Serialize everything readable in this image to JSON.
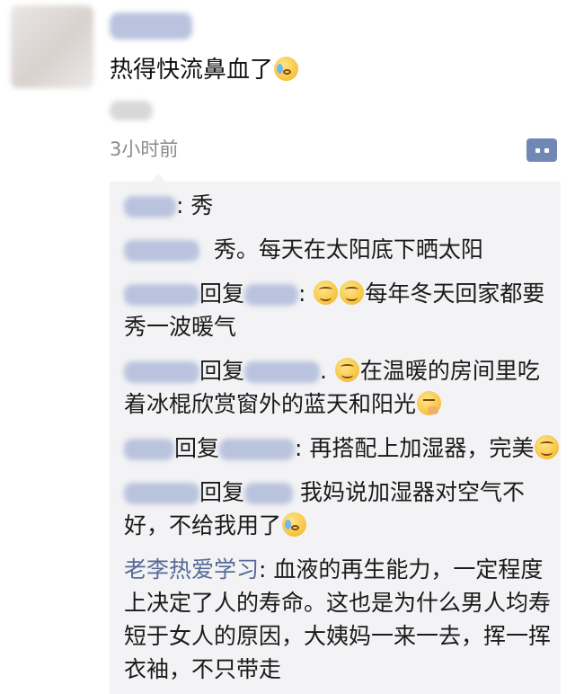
{
  "post": {
    "text": "热得快流鼻血了",
    "text_emoji": "crying-laughing-emoji",
    "time": "3小时前"
  },
  "comments": [
    {
      "sep": ": ",
      "text": "秀"
    },
    {
      "sep": "",
      "text": "秀。每天在太阳底下晒太阳"
    },
    {
      "reply": "回复",
      "sep": ": ",
      "emoji": [
        "grin-emoji",
        "grin-emoji"
      ],
      "text": "每年冬天回家都要秀一波暖气"
    },
    {
      "reply": "回复",
      "sep": ". ",
      "emoji": [
        "grin-emoji"
      ],
      "text": "在温暖的房间里吃着冰棍欣赏窗外的蓝天和阳光",
      "trailing_emoji": "thinking-emoji"
    },
    {
      "reply": "回复",
      "sep": ": ",
      "text": "再搭配上加湿器，完美",
      "trailing_emoji": "grin-emoji"
    },
    {
      "reply": "回复",
      "sep": " ",
      "text": "我妈说加湿器对空气不好，不给我用了",
      "trailing_emoji": "crying-laughing-emoji"
    },
    {
      "name": "老李热爱学习",
      "sep": ": ",
      "text": "血液的再生能力，一定程度上决定了人的寿命。这也是为什么男人均寿短于女人的原因，大姨妈一来一去，挥一挥衣袖，不只带走"
    }
  ],
  "colors": {
    "name_link": "#576b95",
    "comment_bg": "#f3f3f5",
    "time_gray": "#8a8a8a",
    "action_button": "#7187b6"
  }
}
